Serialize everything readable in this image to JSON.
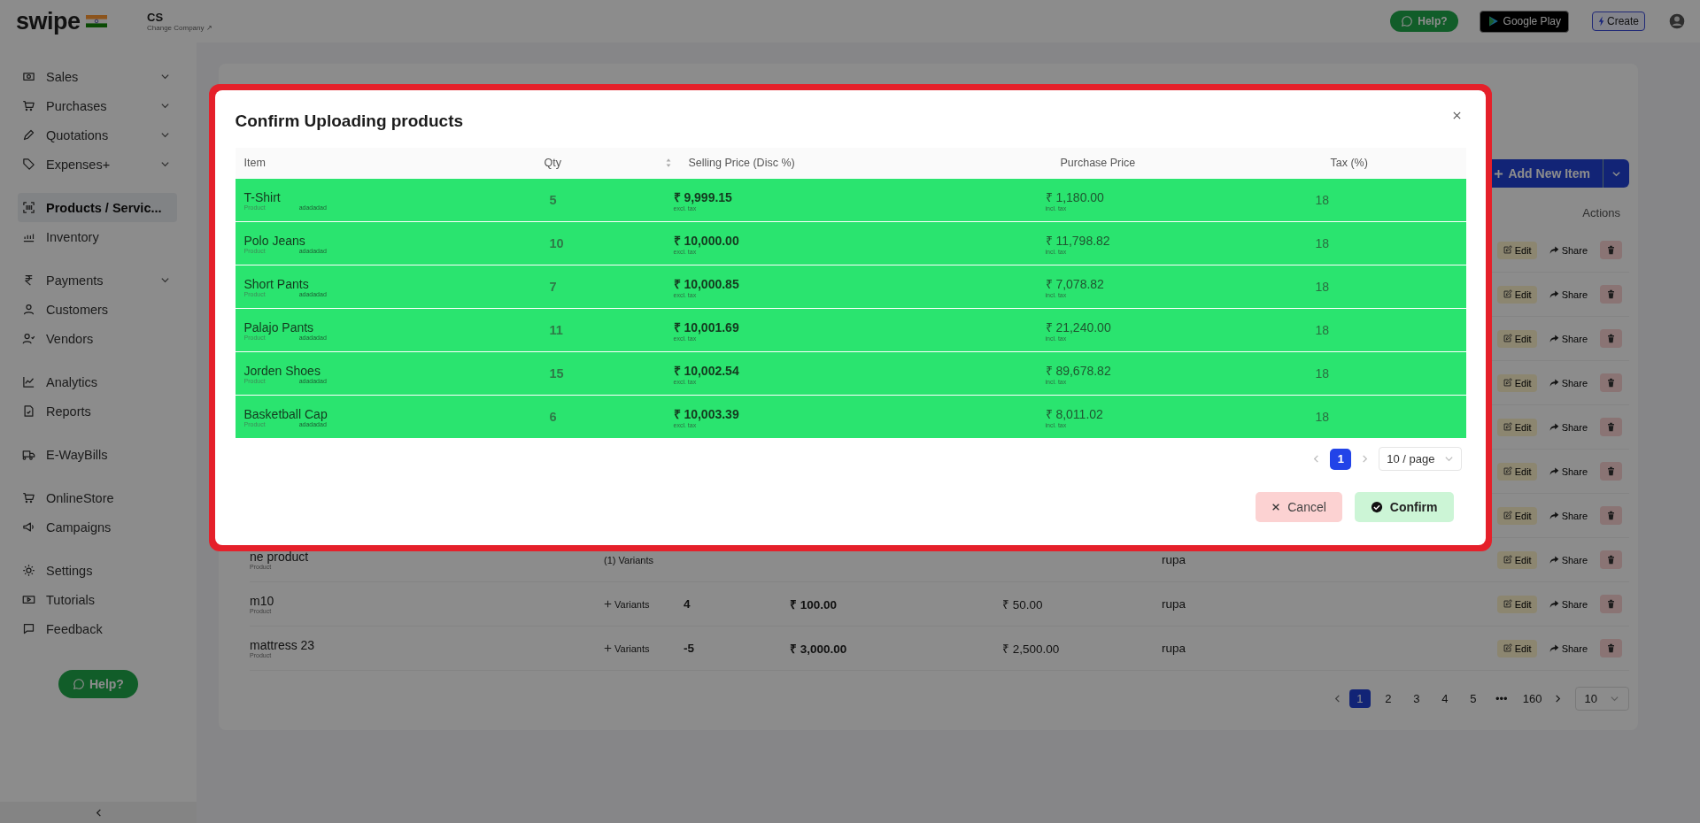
{
  "topbar": {
    "logo": "swipe",
    "company": "CS",
    "change_company": "Change Company ↗",
    "help": "Help?",
    "store_badge": "Google Play",
    "create": "Create"
  },
  "sidebar": {
    "groups": [
      {
        "items": [
          {
            "label": "Sales",
            "expandable": true,
            "selected": false
          },
          {
            "label": "Purchases",
            "expandable": true,
            "selected": false
          },
          {
            "label": "Quotations",
            "expandable": true,
            "selected": false
          },
          {
            "label": "Expenses+",
            "expandable": true,
            "selected": false
          }
        ]
      },
      {
        "items": [
          {
            "label": "Products / Servic...",
            "expandable": false,
            "selected": true
          },
          {
            "label": "Inventory",
            "expandable": false,
            "selected": false
          }
        ]
      },
      {
        "items": [
          {
            "label": "Payments",
            "expandable": true,
            "selected": false
          },
          {
            "label": "Customers",
            "expandable": false,
            "selected": false
          },
          {
            "label": "Vendors",
            "expandable": false,
            "selected": false
          }
        ]
      },
      {
        "items": [
          {
            "label": "Analytics",
            "expandable": false,
            "selected": false
          },
          {
            "label": "Reports",
            "expandable": false,
            "selected": false
          }
        ]
      },
      {
        "items": [
          {
            "label": "E-WayBills",
            "expandable": false,
            "selected": false
          }
        ]
      },
      {
        "items": [
          {
            "label": "OnlineStore",
            "expandable": false,
            "selected": false
          },
          {
            "label": "Campaigns",
            "expandable": false,
            "selected": false
          }
        ]
      },
      {
        "items": [
          {
            "label": "Settings",
            "expandable": false,
            "selected": false
          },
          {
            "label": "Tutorials",
            "expandable": false,
            "selected": false
          },
          {
            "label": "Feedback",
            "expandable": false,
            "selected": false
          }
        ]
      }
    ],
    "help": "Help?"
  },
  "page": {
    "add_button": "Add New Item",
    "actions_heading": "Actions",
    "rows": [
      {
        "edit": "Edit",
        "share": "Share"
      },
      {
        "edit": "Edit",
        "share": "Share"
      },
      {
        "edit": "Edit",
        "share": "Share"
      },
      {
        "edit": "Edit",
        "share": "Share"
      },
      {
        "edit": "Edit",
        "share": "Share"
      },
      {
        "edit": "Edit",
        "share": "Share"
      },
      {
        "edit": "Edit",
        "share": "Share"
      },
      {
        "name": "ne product",
        "type": "Product",
        "variants": {
          "kind": "count",
          "text": "(1) Variants"
        },
        "unit": "rupa",
        "edit": "Edit",
        "share": "Share"
      },
      {
        "name": "m10",
        "type": "Product",
        "variants": {
          "kind": "add",
          "text": "Variants"
        },
        "qty": "4",
        "price": "₹ 100.00",
        "purchase": "₹ 50.00",
        "unit": "rupa",
        "edit": "Edit",
        "share": "Share"
      },
      {
        "name": "mattress 23",
        "type": "Product",
        "variants": {
          "kind": "add",
          "text": "Variants"
        },
        "qty": "-5",
        "price": "₹ 3,000.00",
        "purchase": "₹ 2,500.00",
        "unit": "rupa",
        "edit": "Edit",
        "share": "Share"
      }
    ],
    "pagination": {
      "pages": [
        {
          "label": "1",
          "selected": true
        },
        {
          "label": "2",
          "selected": false
        },
        {
          "label": "3",
          "selected": false
        },
        {
          "label": "4",
          "selected": false
        },
        {
          "label": "5",
          "selected": false
        },
        {
          "label": "•••",
          "selected": false
        },
        {
          "label": "160",
          "selected": false
        }
      ],
      "page_size": "10"
    }
  },
  "modal": {
    "title": "Confirm Uploading products",
    "columns": [
      "Item",
      "Qty",
      "Selling Price (Disc %)",
      "Purchase Price",
      "Tax (%)"
    ],
    "rows": [
      {
        "item": "T-Shirt",
        "type": "Product",
        "note": "adadadad",
        "qty": "5",
        "selling": "₹ 9,999.15",
        "selling_note": "excl. tax",
        "purchase": "₹ 1,180.00",
        "purchase_note": "incl. tax",
        "tax": "18"
      },
      {
        "item": "Polo Jeans",
        "type": "Product",
        "note": "adadadad",
        "qty": "10",
        "selling": "₹ 10,000.00",
        "selling_note": "excl. tax",
        "purchase": "₹ 11,798.82",
        "purchase_note": "incl. tax",
        "tax": "18"
      },
      {
        "item": "Short Pants",
        "type": "Product",
        "note": "adadadad",
        "qty": "7",
        "selling": "₹ 10,000.85",
        "selling_note": "excl. tax",
        "purchase": "₹ 7,078.82",
        "purchase_note": "incl. tax",
        "tax": "18"
      },
      {
        "item": "Palajo Pants",
        "type": "Product",
        "note": "adadadad",
        "qty": "11",
        "selling": "₹ 10,001.69",
        "selling_note": "excl. tax",
        "purchase": "₹ 21,240.00",
        "purchase_note": "incl. tax",
        "tax": "18"
      },
      {
        "item": "Jorden Shoes",
        "type": "Product",
        "note": "adadadad",
        "qty": "15",
        "selling": "₹ 10,002.54",
        "selling_note": "excl. tax",
        "purchase": "₹ 89,678.82",
        "purchase_note": "incl. tax",
        "tax": "18"
      },
      {
        "item": "Basketball Cap",
        "type": "Product",
        "note": "adadadad",
        "qty": "6",
        "selling": "₹ 10,003.39",
        "selling_note": "excl. tax",
        "purchase": "₹ 8,011.02",
        "purchase_note": "incl. tax",
        "tax": "18"
      }
    ],
    "pagination": {
      "pages": [
        {
          "label": "1",
          "selected": true
        }
      ],
      "page_size": "10 / page"
    },
    "cancel": "Cancel",
    "confirm": "Confirm"
  }
}
